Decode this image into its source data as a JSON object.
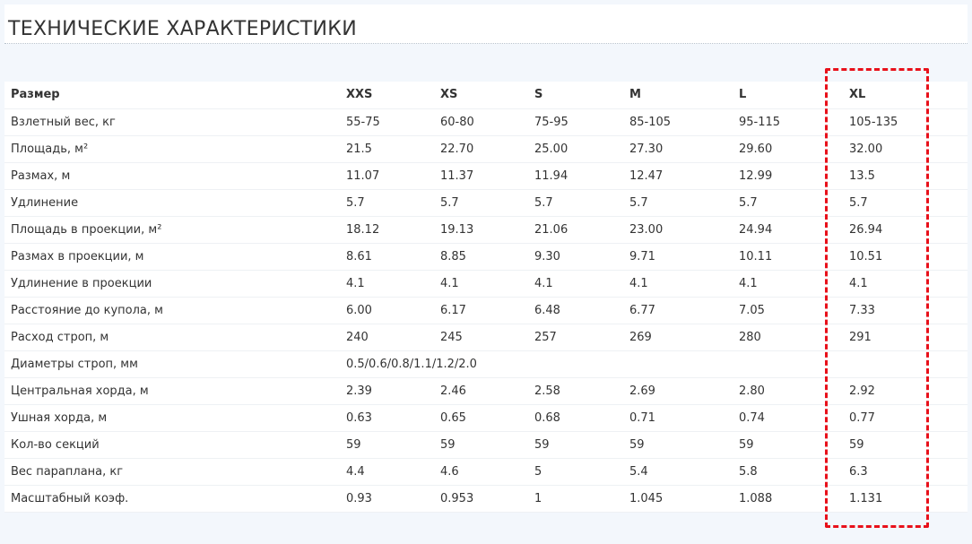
{
  "section": {
    "title": "ТЕХНИЧЕСКИЕ ХАРАКТЕРИСТИКИ"
  },
  "table": {
    "headers": [
      "Размер",
      "XXS",
      "XS",
      "S",
      "M",
      "L",
      "XL"
    ],
    "rows": [
      [
        "Взлетный вес, кг",
        "55-75",
        "60-80",
        "75-95",
        "85-105",
        "95-115",
        "105-135"
      ],
      [
        "Площадь, м²",
        "21.5",
        "22.70",
        "25.00",
        "27.30",
        "29.60",
        "32.00"
      ],
      [
        "Размах, м",
        "11.07",
        "11.37",
        "11.94",
        "12.47",
        "12.99",
        "13.5"
      ],
      [
        "Удлинение",
        "5.7",
        "5.7",
        "5.7",
        "5.7",
        "5.7",
        "5.7"
      ],
      [
        "Площадь в проекции, м²",
        "18.12",
        "19.13",
        "21.06",
        "23.00",
        "24.94",
        "26.94"
      ],
      [
        "Размах в проекции, м",
        "8.61",
        "8.85",
        "9.30",
        "9.71",
        "10.11",
        "10.51"
      ],
      [
        "Удлинение в проекции",
        "4.1",
        "4.1",
        "4.1",
        "4.1",
        "4.1",
        "4.1"
      ],
      [
        "Расстояние до купола, м",
        "6.00",
        "6.17",
        "6.48",
        "6.77",
        "7.05",
        "7.33"
      ],
      [
        "Расход строп, м",
        "240",
        "245",
        "257",
        "269",
        "280",
        "291"
      ],
      [
        "Диаметры строп, мм",
        "0.5/0.6/0.8/1.1/1.2/2.0",
        "",
        "",
        "",
        "",
        ""
      ],
      [
        "Центральная хорда, м",
        "2.39",
        "2.46",
        "2.58",
        "2.69",
        "2.80",
        "2.92"
      ],
      [
        "Ушная хорда, м",
        "0.63",
        "0.65",
        "0.68",
        "0.71",
        "0.74",
        "0.77"
      ],
      [
        "Кол-во секций",
        "59",
        "59",
        "59",
        "59",
        "59",
        "59"
      ],
      [
        "Вес параплана, кг",
        "4.4",
        "4.6",
        "5",
        "5.4",
        "5.8",
        "6.3"
      ],
      [
        "Масштабный коэф.",
        "0.93",
        "0.953",
        "1",
        "1.045",
        "1.088",
        "1.131"
      ]
    ]
  },
  "highlight": {
    "column": "XL",
    "color": "#e8101a",
    "style": "dashed"
  }
}
